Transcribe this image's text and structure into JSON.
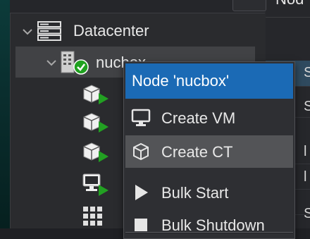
{
  "right_panel": {
    "header": "Nod",
    "letters": [
      "S",
      "S",
      "l",
      "l",
      "S"
    ]
  },
  "tree": {
    "datacenter_label": "Datacenter",
    "node_label": "nucbox",
    "guests": [
      {
        "icon": "container-running-icon"
      },
      {
        "icon": "container-running-icon"
      },
      {
        "icon": "container-running-icon"
      },
      {
        "icon": "vm-running-icon"
      },
      {
        "icon": "storage-icon"
      }
    ]
  },
  "context_menu": {
    "title": "Node 'nucbox'",
    "items": [
      {
        "label": "Create VM",
        "icon": "monitor-icon"
      },
      {
        "label": "Create CT",
        "icon": "cube-icon"
      },
      {
        "label": "Bulk Start",
        "icon": "play-icon"
      },
      {
        "label": "Bulk Shutdown",
        "icon": "stop-icon"
      }
    ]
  }
}
